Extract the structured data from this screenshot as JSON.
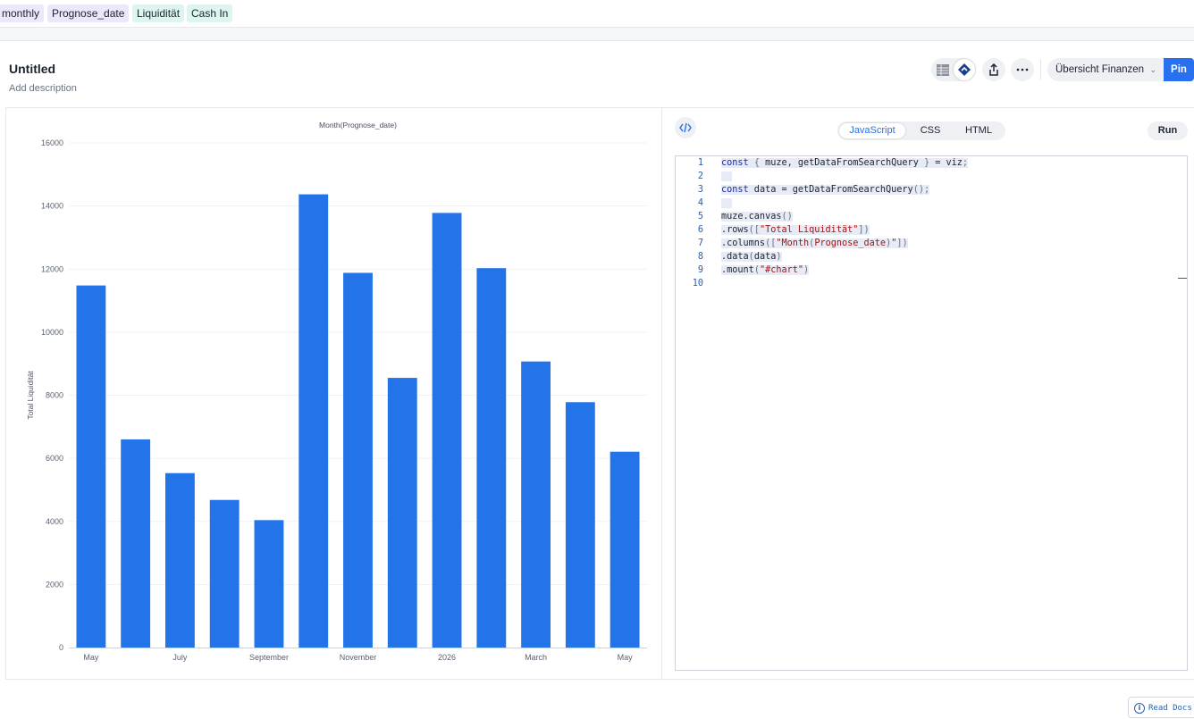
{
  "chips": [
    {
      "label": "monthly",
      "color": "purple"
    },
    {
      "label": "Prognose_date",
      "color": "purple"
    },
    {
      "label": "Liquidität",
      "color": "teal"
    },
    {
      "label": "Cash In",
      "color": "teal"
    }
  ],
  "header": {
    "title": "Untitled",
    "description": "Add description",
    "dropdown_label": "Übersicht Finanzen",
    "pin_label": "Pin"
  },
  "code_panel": {
    "tabs": [
      {
        "label": "JavaScript",
        "active": true
      },
      {
        "label": "CSS",
        "active": false
      },
      {
        "label": "HTML",
        "active": false
      }
    ],
    "run_label": "Run",
    "read_docs_label": "Read Docs",
    "line_numbers": [
      "1",
      "2",
      "3",
      "4",
      "5",
      "6",
      "7",
      "8",
      "9",
      "10"
    ],
    "lines": [
      "const { muze, getDataFromSearchQuery } = viz;",
      "",
      "const data = getDataFromSearchQuery();",
      "",
      "muze.canvas()",
      ".rows([\"Total Liquidität\"])",
      ".columns([\"Month(Prognose_date)\"])",
      ".data(data)",
      ".mount(\"#chart\")",
      ""
    ]
  },
  "chart_data": {
    "type": "bar",
    "title": "Month(Prognose_date)",
    "xlabel": "",
    "ylabel": "Total Liquidität",
    "ylim": [
      0,
      16000
    ],
    "yticks": [
      0,
      2000,
      4000,
      6000,
      8000,
      10000,
      12000,
      14000,
      16000
    ],
    "categories": [
      "May",
      "",
      "July",
      "",
      "September",
      "",
      "November",
      "",
      "2026",
      "",
      "March",
      "",
      "May"
    ],
    "values": [
      11480,
      6600,
      5530,
      4680,
      4040,
      14370,
      11880,
      8550,
      13780,
      12030,
      9070,
      7780,
      6210
    ],
    "bar_color": "#2374e8",
    "grid": true
  }
}
